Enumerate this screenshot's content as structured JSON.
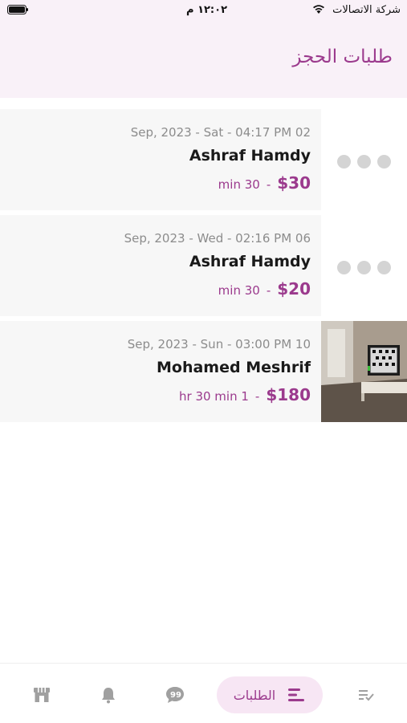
{
  "status_bar": {
    "carrier": "شركة الاتصالات",
    "time": "١٢:٠٢ م"
  },
  "header": {
    "title": "طلبات الحجز"
  },
  "bookings": [
    {
      "date": "Sep, 2023 - Sat - 04:17 PM 02",
      "name": "Ashraf Hamdy",
      "duration": "min 30",
      "price": "$30"
    },
    {
      "date": "Sep, 2023 - Wed - 02:16 PM 06",
      "name": "Ashraf Hamdy",
      "duration": "min 30",
      "price": "$20"
    },
    {
      "date": "Sep, 2023 - Sun - 03:00 PM 10",
      "name": "Mohamed Meshrif",
      "duration": "hr 30 min 1",
      "price": "$180"
    }
  ],
  "tabbar": {
    "active_label": "الطلبات",
    "tabs": [
      "checklist-icon",
      "orders-icon",
      "chat-icon",
      "bell-icon",
      "store-icon"
    ]
  },
  "colors": {
    "accent": "#9b3a8d",
    "header_bg": "#f9f1f8",
    "card_bg": "#f7f7f7"
  }
}
